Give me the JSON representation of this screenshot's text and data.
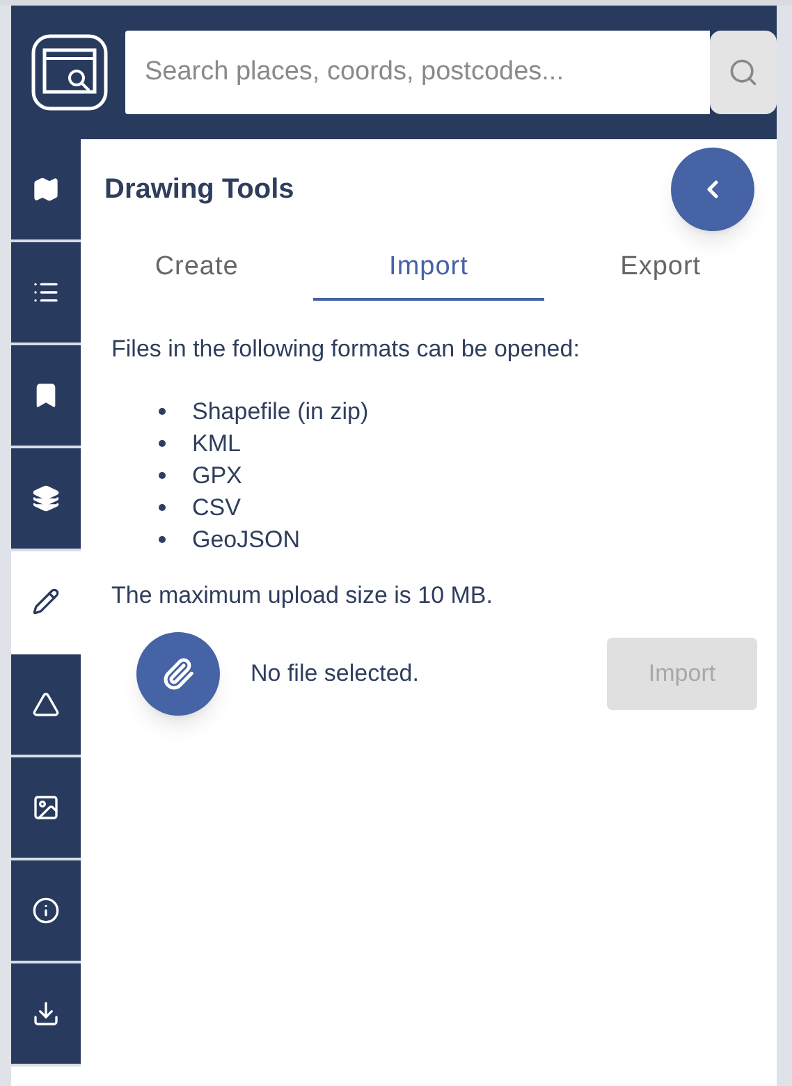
{
  "search": {
    "placeholder": "Search places, coords, postcodes..."
  },
  "sidebar": {
    "items": [
      {
        "selected": false
      },
      {
        "selected": false
      },
      {
        "selected": false
      },
      {
        "selected": false
      },
      {
        "selected": true
      },
      {
        "selected": false
      },
      {
        "selected": false
      },
      {
        "selected": false
      },
      {
        "selected": false
      }
    ]
  },
  "panel": {
    "title": "Drawing Tools",
    "tabs": [
      {
        "label": "Create",
        "selected": false
      },
      {
        "label": "Import",
        "selected": true
      },
      {
        "label": "Export",
        "selected": false
      }
    ],
    "intro": "Files in the following formats can be opened:",
    "formats": [
      "Shapefile (in zip)",
      "KML",
      "GPX",
      "CSV",
      "GeoJSON"
    ],
    "limit": "The maximum upload size is 10 MB.",
    "file_status": "No file selected.",
    "import_button": {
      "label": "Import",
      "disabled": true
    }
  }
}
